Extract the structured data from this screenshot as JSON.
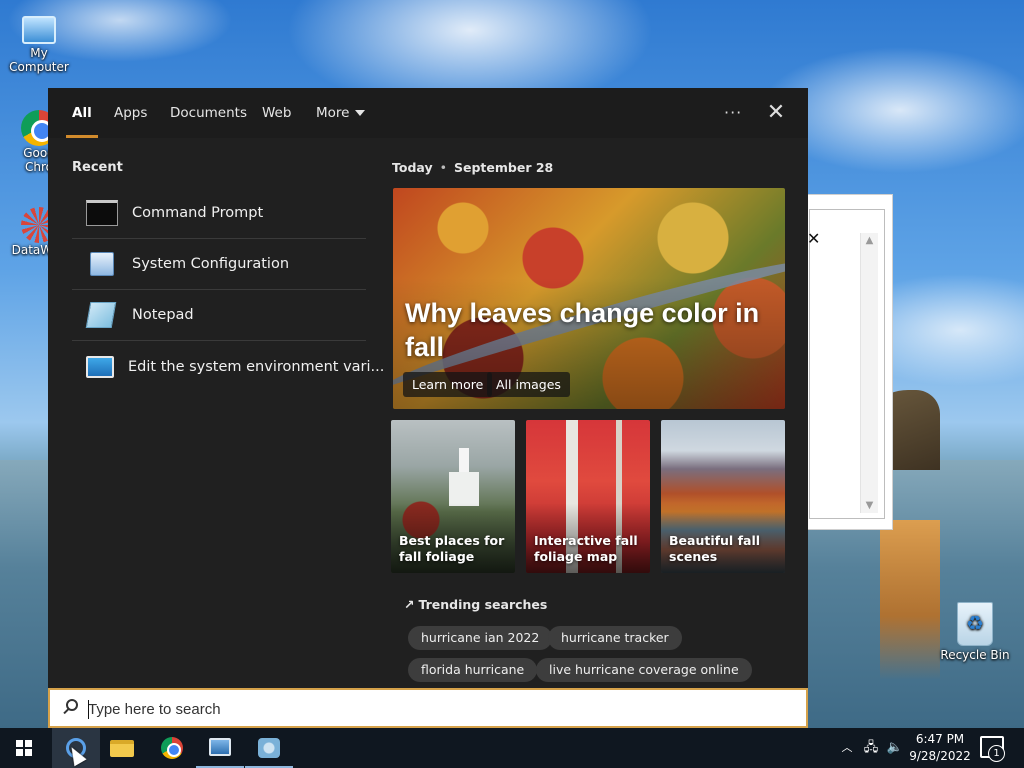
{
  "desktop": {
    "icons": [
      {
        "label": "My Computer"
      },
      {
        "label": "Goog\nChro"
      },
      {
        "label": "DataWag"
      },
      {
        "label": "Recycle Bin"
      }
    ]
  },
  "search_panel": {
    "tabs": [
      {
        "label": "All",
        "active": true
      },
      {
        "label": "Apps"
      },
      {
        "label": "Documents"
      },
      {
        "label": "Web"
      },
      {
        "label": "More"
      }
    ],
    "options_label": "···",
    "close_label": "✕",
    "recent": {
      "title": "Recent",
      "items": [
        {
          "label": "Command Prompt",
          "icon": "command-prompt-icon"
        },
        {
          "label": "System Configuration",
          "icon": "system-configuration-icon"
        },
        {
          "label": "Notepad",
          "icon": "notepad-icon"
        },
        {
          "label": "Edit the system environment vari...",
          "icon": "environment-variables-icon"
        }
      ]
    },
    "today": {
      "label": "Today",
      "date": "September 28"
    },
    "hero": {
      "title": "Why leaves change color in fall",
      "buttons": [
        {
          "label": "Learn more"
        },
        {
          "label": "All images"
        }
      ]
    },
    "thumbnails": [
      {
        "label": "Best places for fall foliage"
      },
      {
        "label": "Interactive fall foliage map"
      },
      {
        "label": "Beautiful fall scenes"
      }
    ],
    "trending": {
      "title": "Trending searches",
      "chips": [
        {
          "label": "hurricane ian 2022"
        },
        {
          "label": "hurricane tracker"
        },
        {
          "label": "florida hurricane"
        },
        {
          "label": "live hurricane coverage online"
        }
      ]
    }
  },
  "searchbox": {
    "placeholder": "Type here to search",
    "value": ""
  },
  "taskbar": {
    "clock_time": "6:47 PM",
    "clock_date": "9/28/2022",
    "notification_count": "1"
  },
  "colors": {
    "accent": "#d28b2c",
    "panel_bg": "#202020",
    "taskbar_bg": "#0f1720"
  }
}
